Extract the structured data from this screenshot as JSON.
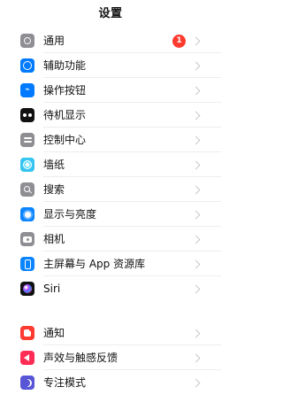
{
  "header": {
    "title": "设置"
  },
  "sections": [
    {
      "items": [
        {
          "label": "通用",
          "icon": "gear-icon",
          "color": "#8e8e93",
          "badge": "1"
        },
        {
          "label": "辅助功能",
          "icon": "accessibility-icon",
          "color": "#007aff"
        },
        {
          "label": "操作按钮",
          "icon": "action-button-icon",
          "color": "#007aff"
        },
        {
          "label": "待机显示",
          "icon": "standby-icon",
          "color": "#111111"
        },
        {
          "label": "控制中心",
          "icon": "control-center-icon",
          "color": "#8e8e93"
        },
        {
          "label": "墙纸",
          "icon": "wallpaper-icon",
          "color": "#36c5f0"
        },
        {
          "label": "搜索",
          "icon": "search-icon",
          "color": "#8e8e93"
        },
        {
          "label": "显示与亮度",
          "icon": "display-brightness-icon",
          "color": "#0a84ff"
        },
        {
          "label": "相机",
          "icon": "camera-icon",
          "color": "#8e8e93"
        },
        {
          "label": "主屏幕与 App 资源库",
          "icon": "home-screen-icon",
          "color": "#0a84ff"
        },
        {
          "label": "Siri",
          "icon": "siri-icon",
          "color": "#111111"
        }
      ]
    },
    {
      "items": [
        {
          "label": "通知",
          "icon": "notifications-icon",
          "color": "#ff3b30"
        },
        {
          "label": "声效与触感反馈",
          "icon": "sound-haptics-icon",
          "color": "#ff2d55"
        },
        {
          "label": "专注模式",
          "icon": "focus-icon",
          "color": "#5856d6"
        }
      ]
    }
  ]
}
